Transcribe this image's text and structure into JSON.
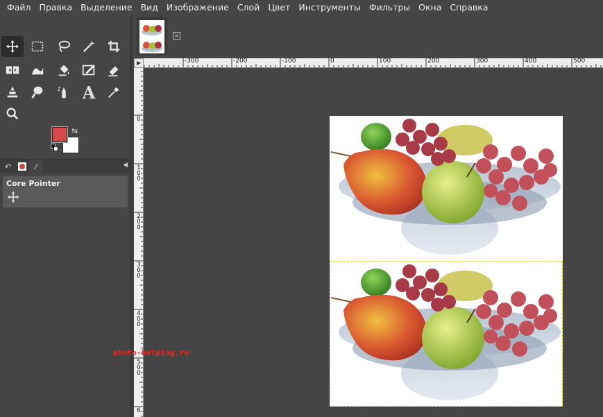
{
  "menubar": {
    "items": [
      "Файл",
      "Правка",
      "Выделение",
      "Вид",
      "Изображение",
      "Слой",
      "Цвет",
      "Инструменты",
      "Фильтры",
      "Окна",
      "Справка"
    ]
  },
  "toolbox": {
    "tools": [
      "move-tool",
      "rect-select-tool",
      "free-select-tool",
      "fuzzy-select-tool",
      "crop-tool",
      "flip-tool",
      "warp-transform-tool",
      "bucket-fill-tool",
      "paintbrush-tool",
      "eraser-tool",
      "clone-tool",
      "smudge-tool",
      "ink-tool",
      "text-tool",
      "color-picker-tool",
      "zoom-tool"
    ],
    "active_tool": "move-tool",
    "foreground_color": "#d44a4a",
    "background_color": "#ffffff"
  },
  "tool_options": {
    "title": "Core Pointer"
  },
  "rulers": {
    "horizontal_labels": [
      "-300",
      "-200",
      "-100",
      "0",
      "100",
      "200",
      "300",
      "400",
      "500"
    ],
    "vertical_labels": [
      "0",
      "100",
      "200",
      "300",
      "400",
      "500",
      "6"
    ]
  },
  "watermark": "photo-helping.ru"
}
